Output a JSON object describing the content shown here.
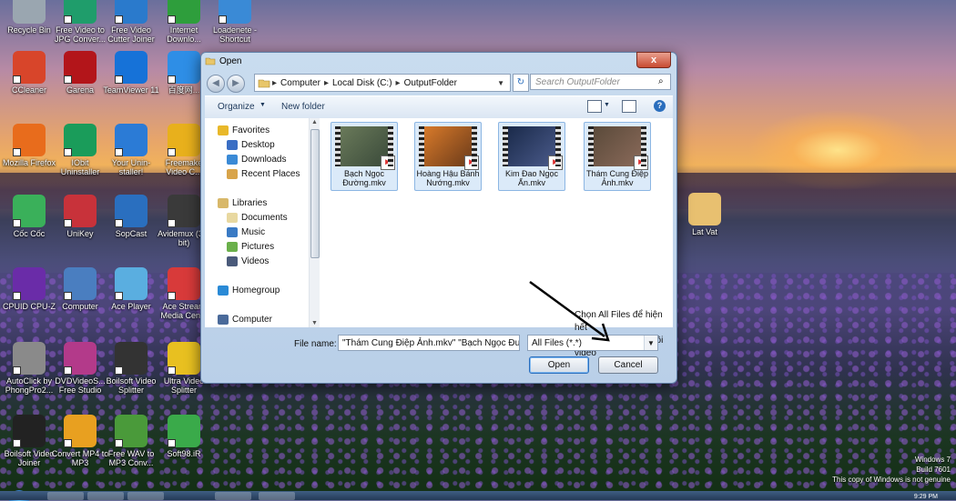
{
  "desktop": {
    "icons": [
      {
        "label": "Recycle Bin",
        "color": "#9aa6b0"
      },
      {
        "label": "Free Video to JPG Conver...",
        "color": "#1f9d6b"
      },
      {
        "label": "Free Video Cutter Joiner",
        "color": "#2a7acc"
      },
      {
        "label": "Internet Downlo...",
        "color": "#2e9e3c"
      },
      {
        "label": "Loadenete - Shortcut",
        "color": "#3a8ad6"
      },
      {
        "label": "CCleaner",
        "color": "#d8452a"
      },
      {
        "label": "Garena",
        "color": "#b3151a"
      },
      {
        "label": "TeamViewer 11",
        "color": "#1672d8"
      },
      {
        "label": "百度网...",
        "color": "#2e8ee6"
      },
      {
        "label": "Mozilla Firefox",
        "color": "#e86c1c"
      },
      {
        "label": "IObit Uninstaller",
        "color": "#1a9c5a"
      },
      {
        "label": "Your Unin-staller!",
        "color": "#2b7bd6"
      },
      {
        "label": "Freemake Video C...",
        "color": "#e8b01c"
      },
      {
        "label": "Cốc Cốc",
        "color": "#3ab05a"
      },
      {
        "label": "UniKey",
        "color": "#c8323a"
      },
      {
        "label": "SopCast",
        "color": "#2a6fbf"
      },
      {
        "label": "Avidemux (32-bit)",
        "color": "#3a3a3a"
      },
      {
        "label": "CPUID CPU-Z",
        "color": "#6a2ca8"
      },
      {
        "label": "Computer",
        "color": "#4a7ec0"
      },
      {
        "label": "Ace Player",
        "color": "#5aaee0"
      },
      {
        "label": "Ace Stream Media Cen...",
        "color": "#d83a3a"
      },
      {
        "label": "AutoClick by PhongPro2...",
        "color": "#8a8a8a"
      },
      {
        "label": "DVDVideoS... Free Studio",
        "color": "#b33a8a"
      },
      {
        "label": "Boilsoft Video Splitter",
        "color": "#333333"
      },
      {
        "label": "Ultra Video Splitter",
        "color": "#e8c020"
      },
      {
        "label": "Boilsoft Video Joiner",
        "color": "#222222"
      },
      {
        "label": "Convert MP4 to MP3",
        "color": "#e8a020"
      },
      {
        "label": "Free WAV to MP3 Conv...",
        "color": "#4a9a3a"
      },
      {
        "label": "Soft98.iR",
        "color": "#3aaa4a"
      },
      {
        "label": "Lat Vat",
        "color": "#e8c070"
      }
    ],
    "watermark": {
      "line1": "Windows 7",
      "line2": "Build 7601",
      "line3": "This copy of Windows is not genuine"
    },
    "clock": "9:29 PM"
  },
  "dialog": {
    "title": "Open",
    "close": "x",
    "back": "◀",
    "forward": "▶",
    "breadcrumb": [
      "Computer",
      "Local Disk (C:)",
      "OutputFolder"
    ],
    "refresh": "↻",
    "search_placeholder": "Search OutputFolder",
    "toolbar": {
      "organize": "Organize",
      "new_folder": "New folder",
      "help": "?"
    },
    "nav": [
      {
        "label": "Favorites",
        "type": "group",
        "color": "#e8b82a"
      },
      {
        "label": "Desktop",
        "type": "item",
        "color": "#3a6ec4"
      },
      {
        "label": "Downloads",
        "type": "item",
        "color": "#3a8ad6"
      },
      {
        "label": "Recent Places",
        "type": "item",
        "color": "#d8a44a"
      },
      {
        "label": "Libraries",
        "type": "group",
        "color": "#d8b86a"
      },
      {
        "label": "Documents",
        "type": "item",
        "color": "#e8d8a0"
      },
      {
        "label": "Music",
        "type": "item",
        "color": "#3a7ac4"
      },
      {
        "label": "Pictures",
        "type": "item",
        "color": "#6ab04a"
      },
      {
        "label": "Videos",
        "type": "item",
        "color": "#4a5a7a"
      },
      {
        "label": "Homegroup",
        "type": "group",
        "color": "#2a8ad6"
      },
      {
        "label": "Computer",
        "type": "group",
        "color": "#4a6a9a"
      }
    ],
    "files": [
      {
        "name": "Bạch Ngọc Đường.mkv",
        "color1": "#6a7a5a",
        "color2": "#3a4a3a"
      },
      {
        "name": "Hoàng Hậu Bánh Nướng.mkv",
        "color1": "#d87a2a",
        "color2": "#6a3a1a"
      },
      {
        "name": "Kim Đao Ngọc Ấn.mkv",
        "color1": "#1a2a4a",
        "color2": "#4a5a8a"
      },
      {
        "name": "Thám Cung Điệp Ảnh.mkv",
        "color1": "#5a4a3a",
        "color2": "#8a6a5a"
      }
    ],
    "annotation": {
      "line1": "Chọn All Files để hiện hết",
      "line2": "những định dạng đuôi video"
    },
    "filename_label": "File name:",
    "filename_value": "\"Thám Cung Điệp Ảnh.mkv\" \"Bạch Ngọc Đườ",
    "filetype_value": "All Files (*.*)",
    "open_button": "Open",
    "cancel_button": "Cancel"
  }
}
